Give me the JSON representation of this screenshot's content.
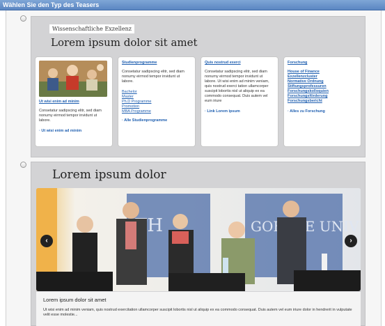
{
  "window": {
    "title": "Wählen Sie den Typ des Teasers"
  },
  "option1": {
    "kicker": "Wissenschaftliche Exzellenz",
    "title": "Lorem ipsum dolor sit amet",
    "cards": [
      {
        "head": "Ut wisi enim ad minim",
        "text": "Consetatur sadipscing elitr, sed diam nonumy eirmod tempor invidunt ut labore.",
        "more": "· Ut wisi enim ad minim"
      },
      {
        "head": "Studienprogramme",
        "text": "Consetatur sadipscing elitr, sed diam nonumy eirmod tempor invidunt ut labore.",
        "links": [
          "Bachelor",
          "Master",
          "Ph.D Programme",
          "Promotion",
          "MBA Programme"
        ],
        "more": "· Alle Studienprogramme"
      },
      {
        "head": "Quis nostrud exerci",
        "text": "Consetatur sadipscing elitr, sed diam nonumy eirmod tempor invidunt ut labore. Ut wisi enim ad minim veniam, quis nostrud exerci tation ullamcorper suscipit lobortis nisl ut aliquip ex ea commodo consequat. Duis autem vel eum iriure",
        "more": "· Link Lorem ipsum"
      },
      {
        "head": "Forschung",
        "links": [
          "House of Finance",
          "Exzellenzcluster",
          "Normative Ordnung",
          "Stiftungsprofessuren",
          "Forschungskolloquien",
          "Forschungsförderung",
          "Forschungsbericht"
        ],
        "more": "· Alles zu Forschung"
      }
    ]
  },
  "option2": {
    "title": "Lorem ipsum dolor",
    "caption_title": "Lorem ipsum dolor sit amet",
    "caption_text": "Ut wisi enim ad minim veniam, quis nostrud exercitation ullamcorper suscipit lobortis nisl ut aliquip ex ea commodo consequat. Duis autem vel eum iriure dolor in hendrerit in vulputate velit esse molestie...",
    "banner_text": "GOETHE UNIVERSITÄT",
    "banner_text_left": "TH",
    "prev_icon": "‹",
    "next_icon": "›"
  },
  "colors": {
    "link": "#1f5fb0",
    "panel": "#d3d3d5",
    "titlebar": "#5b86c2"
  }
}
